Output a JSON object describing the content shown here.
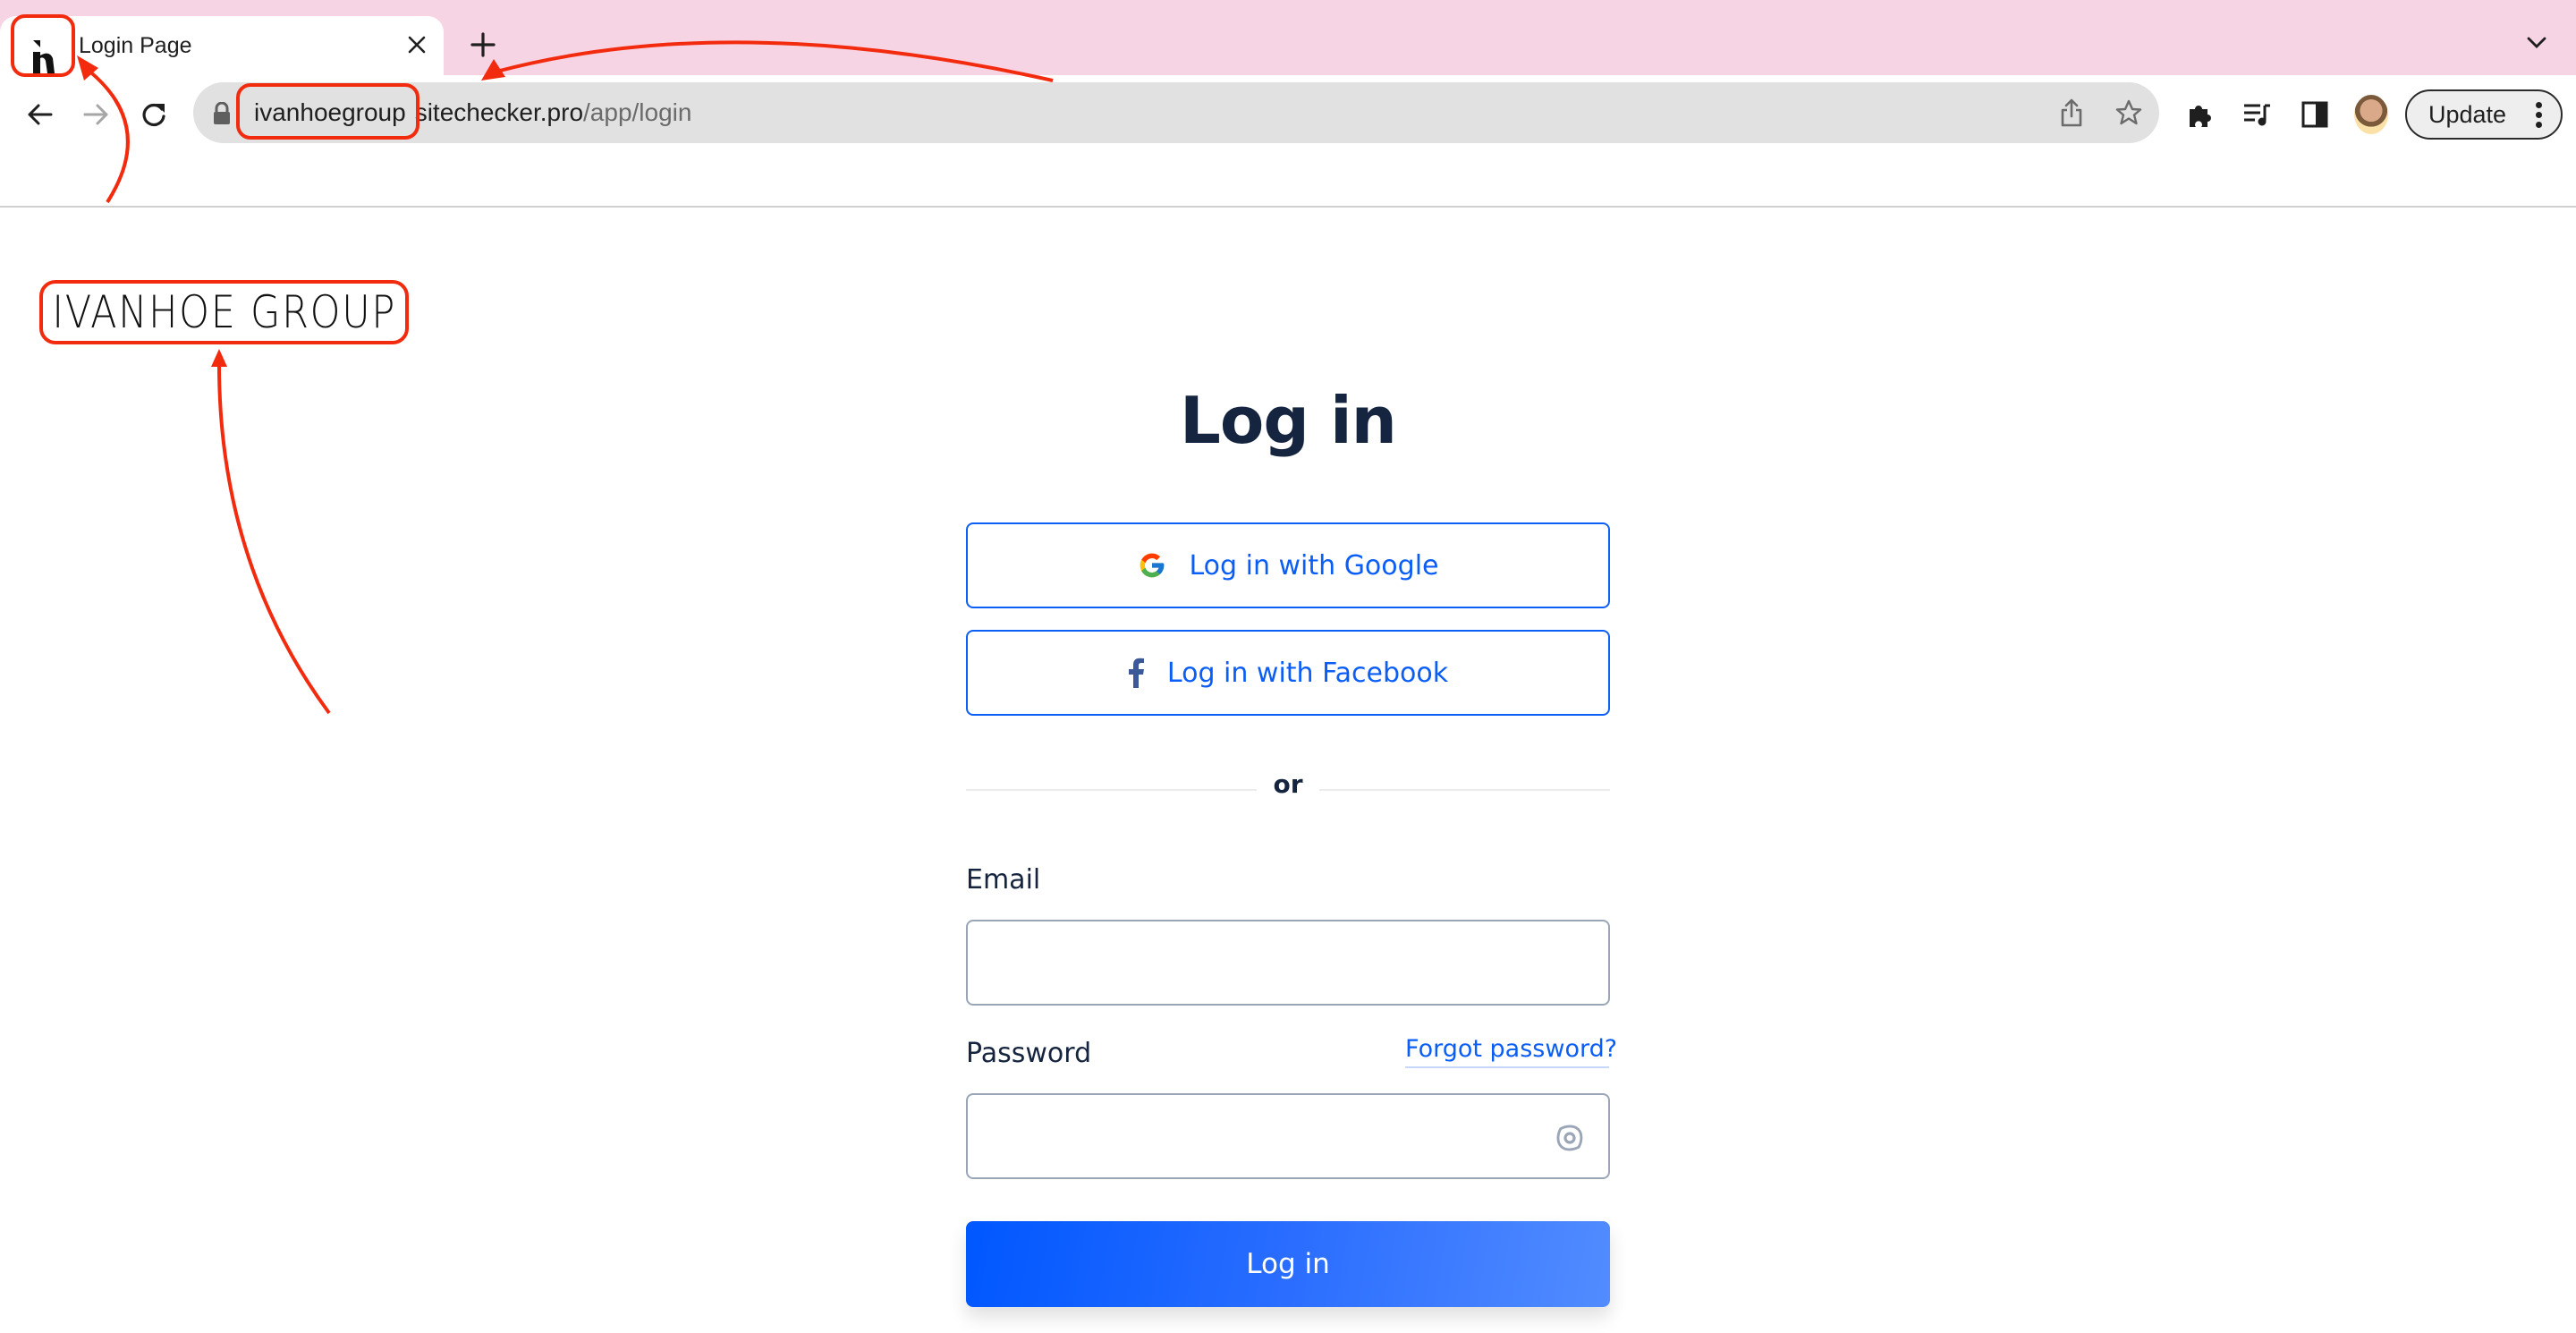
{
  "browser": {
    "tab": {
      "title": "Login Page",
      "favicon": "ivanhoe-h-logo"
    },
    "new_tab_label": "+",
    "address_bar": {
      "host_highlighted": "ivanhoegroup",
      "host_rest": "sitechecker.pro",
      "path": "/app/login",
      "icons": [
        "lock-icon",
        "share-icon",
        "bookmark-star-icon"
      ]
    },
    "toolbar_icons": [
      "back-icon",
      "forward-icon",
      "reload-icon",
      "extensions-puzzle-icon",
      "media-playlist-icon",
      "side-panel-icon",
      "profile-avatar"
    ],
    "update_button_label": "Update"
  },
  "page": {
    "brand": "IVANHOE GROUP",
    "heading": "Log in",
    "google_button_label": "Log in with Google",
    "facebook_button_label": "Log in with Facebook",
    "divider_text": "or",
    "email": {
      "label": "Email",
      "value": "",
      "placeholder": ""
    },
    "password": {
      "label": "Password",
      "value": "",
      "placeholder": "",
      "forgot_link": "Forgot password?"
    },
    "submit_label": "Log in"
  },
  "colors": {
    "accent": "#0a5ef5",
    "heading": "#16253f",
    "tabstrip": "#f7d4e4",
    "annotation": "#f22b0f"
  }
}
